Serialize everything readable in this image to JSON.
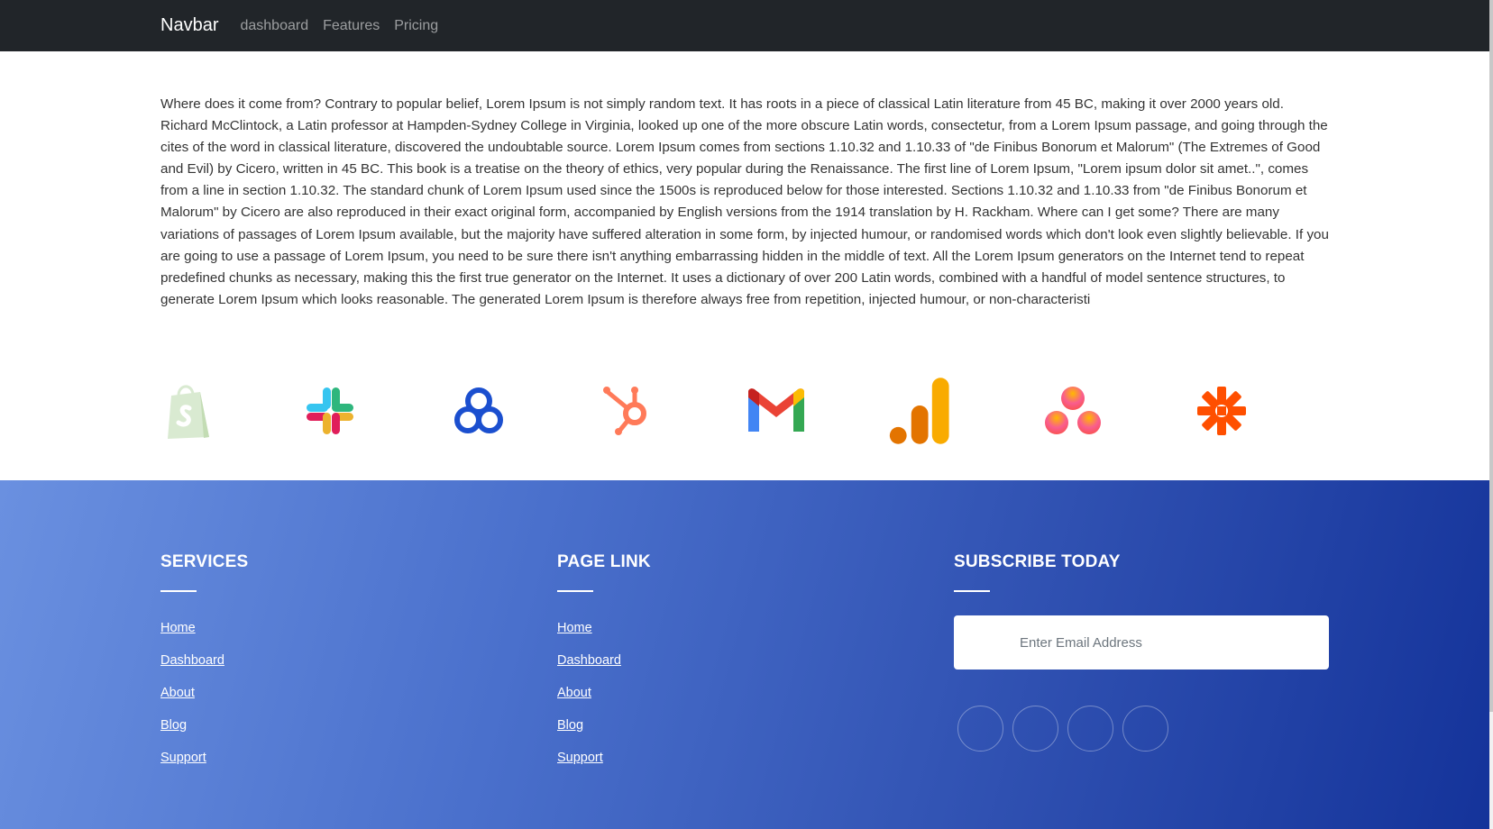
{
  "navbar": {
    "brand": "Navbar",
    "links": [
      "dashboard",
      "Features",
      "Pricing"
    ]
  },
  "content": {
    "paragraph": "Where does it come from? Contrary to popular belief, Lorem Ipsum is not simply random text. It has roots in a piece of classical Latin literature from 45 BC, making it over 2000 years old. Richard McClintock, a Latin professor at Hampden-Sydney College in Virginia, looked up one of the more obscure Latin words, consectetur, from a Lorem Ipsum passage, and going through the cites of the word in classical literature, discovered the undoubtable source. Lorem Ipsum comes from sections 1.10.32 and 1.10.33 of \"de Finibus Bonorum et Malorum\" (The Extremes of Good and Evil) by Cicero, written in 45 BC. This book is a treatise on the theory of ethics, very popular during the Renaissance. The first line of Lorem Ipsum, \"Lorem ipsum dolor sit amet..\", comes from a line in section 1.10.32. The standard chunk of Lorem Ipsum used since the 1500s is reproduced below for those interested. Sections 1.10.32 and 1.10.33 from \"de Finibus Bonorum et Malorum\" by Cicero are also reproduced in their exact original form, accompanied by English versions from the 1914 translation by H. Rackham. Where can I get some? There are many variations of passages of Lorem Ipsum available, but the majority have suffered alteration in some form, by injected humour, or randomised words which don't look even slightly believable. If you are going to use a passage of Lorem Ipsum, you need to be sure there isn't anything embarrassing hidden in the middle of text. All the Lorem Ipsum generators on the Internet tend to repeat predefined chunks as necessary, making this the first true generator on the Internet. It uses a dictionary of over 200 Latin words, combined with a handful of model sentence structures, to generate Lorem Ipsum which looks reasonable. The generated Lorem Ipsum is therefore always free from repetition, injected humour, or non-characteristi"
  },
  "logos": [
    "shopify-icon",
    "slack-icon",
    "circles-icon",
    "hubspot-icon",
    "gmail-icon",
    "analytics-icon",
    "asana-icon",
    "zapier-icon"
  ],
  "footer": {
    "services": {
      "title": "SERVICES",
      "links": [
        "Home",
        "Dashboard",
        "About",
        "Blog",
        "Support"
      ]
    },
    "page_link": {
      "title": "PAGE LINK",
      "links": [
        "Home",
        "Dashboard",
        "About",
        "Blog",
        "Support"
      ]
    },
    "subscribe": {
      "title": "SUBSCRIBE TODAY",
      "placeholder": "Enter Email Address"
    },
    "social_icons": [
      "social-icon-1",
      "social-icon-2",
      "social-icon-3",
      "social-icon-4"
    ]
  },
  "colors": {
    "navbar_bg": "#212529",
    "footer_gradient_start": "#6a90e0",
    "footer_gradient_end": "#14339a"
  }
}
